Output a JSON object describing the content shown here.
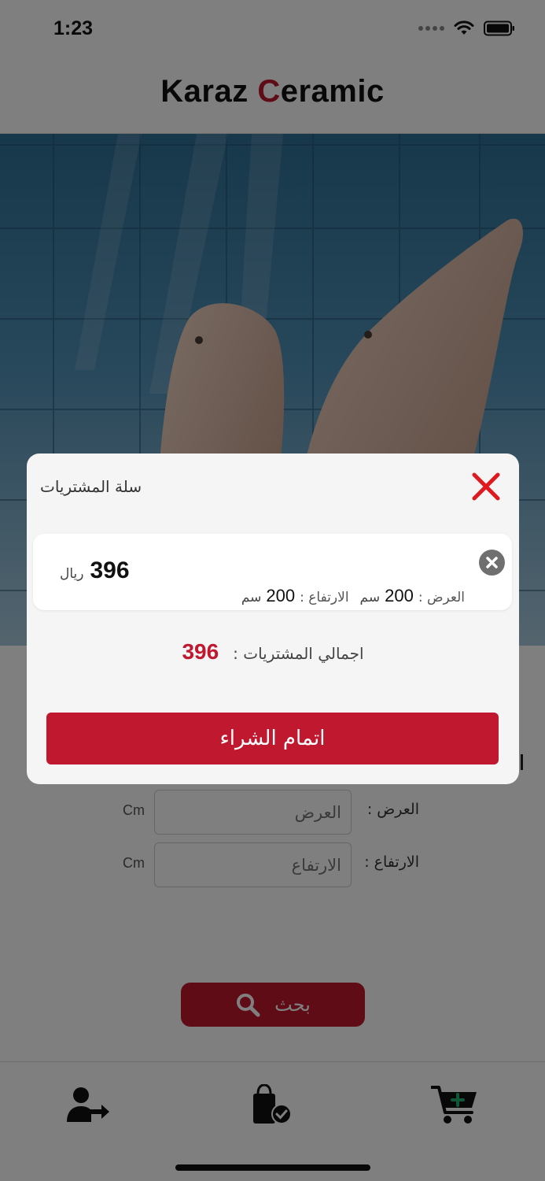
{
  "status_bar": {
    "time": "1:23"
  },
  "header": {
    "brand_part1": "Karaz ",
    "brand_accent": "C",
    "brand_part2": "eramic"
  },
  "form": {
    "width_label": "العرض :",
    "width_placeholder": "العرض",
    "height_label": "الارتفاع :",
    "height_placeholder": "الارتفاع",
    "unit": "Cm",
    "search_label": "بحث"
  },
  "tab_bar": {
    "items": [
      {
        "icon": "user-logout-icon"
      },
      {
        "icon": "shopping-bag-check-icon"
      },
      {
        "icon": "cart-add-icon"
      }
    ]
  },
  "modal": {
    "title": "سلة المشتريات",
    "item": {
      "price": "396",
      "currency": "ريال",
      "width_label": "العرض :",
      "width_value": "200",
      "height_label": "الارتفاع :",
      "height_value": "200",
      "unit": "سم"
    },
    "total_label": "اجمالي المشتريات :",
    "total_value": "396",
    "checkout_label": "اتمام الشراء"
  },
  "colors": {
    "accent": "#c0182f",
    "overlay": "rgba(0,0,0,0.5)"
  }
}
